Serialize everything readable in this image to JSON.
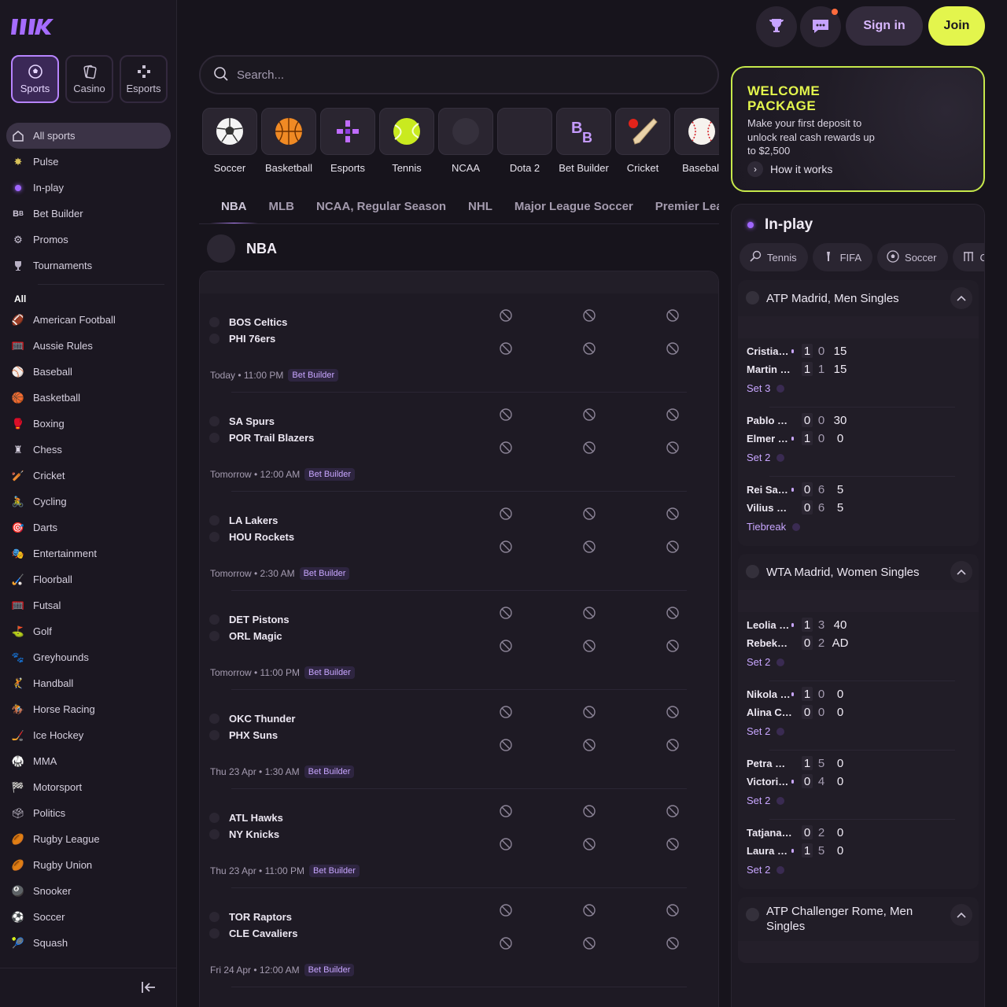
{
  "header": {
    "signin_label": "Sign in",
    "join_label": "Join"
  },
  "top_tabs": [
    {
      "label": "Sports",
      "icon": "soccer-ball-icon",
      "active": true
    },
    {
      "label": "Casino",
      "icon": "cards-icon",
      "active": false
    },
    {
      "label": "Esports",
      "icon": "gamepad-icon",
      "active": false
    }
  ],
  "nav_main": [
    {
      "label": "All sports",
      "icon": "home-icon",
      "active": true
    },
    {
      "label": "Pulse",
      "icon": "pulse-icon"
    },
    {
      "label": "In-play",
      "icon": "live-icon"
    },
    {
      "label": "Bet Builder",
      "icon": "bet-builder-icon"
    },
    {
      "label": "Promos",
      "icon": "promo-icon"
    },
    {
      "label": "Tournaments",
      "icon": "trophy-icon"
    }
  ],
  "nav_all_label": "All",
  "nav_sports": [
    {
      "label": "American Football",
      "emoji": "🏈"
    },
    {
      "label": "Aussie Rules",
      "emoji": "🥅"
    },
    {
      "label": "Baseball",
      "emoji": "⚾"
    },
    {
      "label": "Basketball",
      "emoji": "🏀"
    },
    {
      "label": "Boxing",
      "emoji": "🥊"
    },
    {
      "label": "Chess",
      "emoji": "♜"
    },
    {
      "label": "Cricket",
      "emoji": "🏏"
    },
    {
      "label": "Cycling",
      "emoji": "🚴"
    },
    {
      "label": "Darts",
      "emoji": "🎯"
    },
    {
      "label": "Entertainment",
      "emoji": "🎭"
    },
    {
      "label": "Floorball",
      "emoji": "🏑"
    },
    {
      "label": "Futsal",
      "emoji": "🥅"
    },
    {
      "label": "Golf",
      "emoji": "⛳"
    },
    {
      "label": "Greyhounds",
      "emoji": "🐾"
    },
    {
      "label": "Handball",
      "emoji": "🤾"
    },
    {
      "label": "Horse Racing",
      "emoji": "🏇"
    },
    {
      "label": "Ice Hockey",
      "emoji": "🏒"
    },
    {
      "label": "MMA",
      "emoji": "🥋"
    },
    {
      "label": "Motorsport",
      "emoji": "🏁"
    },
    {
      "label": "Politics",
      "emoji": "🗳"
    },
    {
      "label": "Rugby League",
      "emoji": "🏉"
    },
    {
      "label": "Rugby Union",
      "emoji": "🏉"
    },
    {
      "label": "Snooker",
      "emoji": "🎱"
    },
    {
      "label": "Soccer",
      "emoji": "⚽"
    },
    {
      "label": "Squash",
      "emoji": "🎾"
    }
  ],
  "search": {
    "placeholder": "Search..."
  },
  "sport_tiles": [
    {
      "label": "Soccer",
      "icon": "soccer-ball-icon"
    },
    {
      "label": "Basketball",
      "icon": "basketball-icon"
    },
    {
      "label": "Esports",
      "icon": "gamepad-icon"
    },
    {
      "label": "Tennis",
      "icon": "tennis-ball-icon"
    },
    {
      "label": "NCAA",
      "icon": "ncaa-icon"
    },
    {
      "label": "Dota 2",
      "icon": "dota-icon"
    },
    {
      "label": "Bet Builder",
      "icon": "bet-builder-icon"
    },
    {
      "label": "Cricket",
      "icon": "cricket-icon"
    },
    {
      "label": "Baseball",
      "icon": "baseball-icon"
    }
  ],
  "league_tabs": [
    {
      "label": "NBA",
      "active": true
    },
    {
      "label": "MLB"
    },
    {
      "label": "NCAA, Regular Season"
    },
    {
      "label": "NHL"
    },
    {
      "label": "Major League Soccer"
    },
    {
      "label": "Premier League"
    }
  ],
  "competition": {
    "title": "NBA"
  },
  "games": [
    {
      "home": "BOS Celtics",
      "away": "PHI 76ers",
      "time": "Today • 11:00 PM",
      "badge": "Bet Builder"
    },
    {
      "home": "SA Spurs",
      "away": "POR Trail Blazers",
      "time": "Tomorrow • 12:00 AM",
      "badge": "Bet Builder"
    },
    {
      "home": "LA Lakers",
      "away": "HOU Rockets",
      "time": "Tomorrow • 2:30 AM",
      "badge": "Bet Builder"
    },
    {
      "home": "DET Pistons",
      "away": "ORL Magic",
      "time": "Tomorrow • 11:00 PM",
      "badge": "Bet Builder"
    },
    {
      "home": "OKC Thunder",
      "away": "PHX Suns",
      "time": "Thu 23 Apr • 1:30 AM",
      "badge": "Bet Builder"
    },
    {
      "home": "ATL Hawks",
      "away": "NY Knicks",
      "time": "Thu 23 Apr • 11:00 PM",
      "badge": "Bet Builder"
    },
    {
      "home": "TOR Raptors",
      "away": "CLE Cavaliers",
      "time": "Fri 24 Apr • 12:00 AM",
      "badge": "Bet Builder"
    }
  ],
  "promo": {
    "title": "WELCOME PACKAGE",
    "text": "Make your first deposit to unlock real cash rewards up to $2,500",
    "link": "How it works"
  },
  "inplay": {
    "title": "In-play",
    "chips": [
      {
        "label": "Tennis",
        "icon": "tennis-racket-icon"
      },
      {
        "label": "FIFA",
        "icon": "fifa-icon"
      },
      {
        "label": "Soccer",
        "icon": "soccer-ball-icon"
      },
      {
        "label": "Cricket",
        "icon": "cricket-icon"
      }
    ],
    "competitions": [
      {
        "name": "ATP Madrid, Men Singles",
        "matches": [
          {
            "p1": "Cristian Garin",
            "p2": "Martin Landaluce",
            "serve": 1,
            "s1": [
              "1",
              "1"
            ],
            "s2": [
              "0",
              "1"
            ],
            "s3": [
              "15",
              "15"
            ],
            "status": "Set 3"
          },
          {
            "p1": "Pablo Llamas",
            "p2": "Elmer Moller",
            "serve": 2,
            "s1": [
              "0",
              "1"
            ],
            "s2": [
              "0",
              "0"
            ],
            "s3": [
              "30",
              "0"
            ],
            "status": "Set 2"
          },
          {
            "p1": "Rei Sakamoto",
            "p2": "Vilius Gaubas",
            "serve": 1,
            "s1": [
              "0",
              "0"
            ],
            "s2": [
              "6",
              "6"
            ],
            "s3": [
              "5",
              "5"
            ],
            "status": "Tiebreak"
          }
        ]
      },
      {
        "name": "WTA Madrid, Women Singles",
        "matches": [
          {
            "p1": "Leolia Jeanjean",
            "p2": "Rebeka Masarova",
            "serve": 1,
            "s1": [
              "1",
              "0"
            ],
            "s2": [
              "3",
              "2"
            ],
            "s3": [
              "40",
              "AD"
            ],
            "status": "Set 2"
          },
          {
            "p1": "Nikola Bartunkova",
            "p2": "Alina Charaeva",
            "serve": 1,
            "s1": [
              "1",
              "0"
            ],
            "s2": [
              "0",
              "0"
            ],
            "s3": [
              "0",
              "0"
            ],
            "status": "Set 2"
          },
          {
            "p1": "Petra Marcinko",
            "p2": "Victoria Jimenez",
            "serve": 2,
            "s1": [
              "1",
              "0"
            ],
            "s2": [
              "5",
              "4"
            ],
            "s3": [
              "0",
              "0"
            ],
            "status": "Set 2"
          },
          {
            "p1": "Tatjana Maria",
            "p2": "Laura Siegemund",
            "serve": 2,
            "s1": [
              "0",
              "1"
            ],
            "s2": [
              "2",
              "5"
            ],
            "s3": [
              "0",
              "0"
            ],
            "status": "Set 2"
          }
        ]
      },
      {
        "name": "ATP Challenger Rome, Men Singles",
        "matches": []
      }
    ]
  },
  "colors": {
    "accent": "#b784ff",
    "join": "#e3f54d",
    "bg": "#17141c"
  }
}
